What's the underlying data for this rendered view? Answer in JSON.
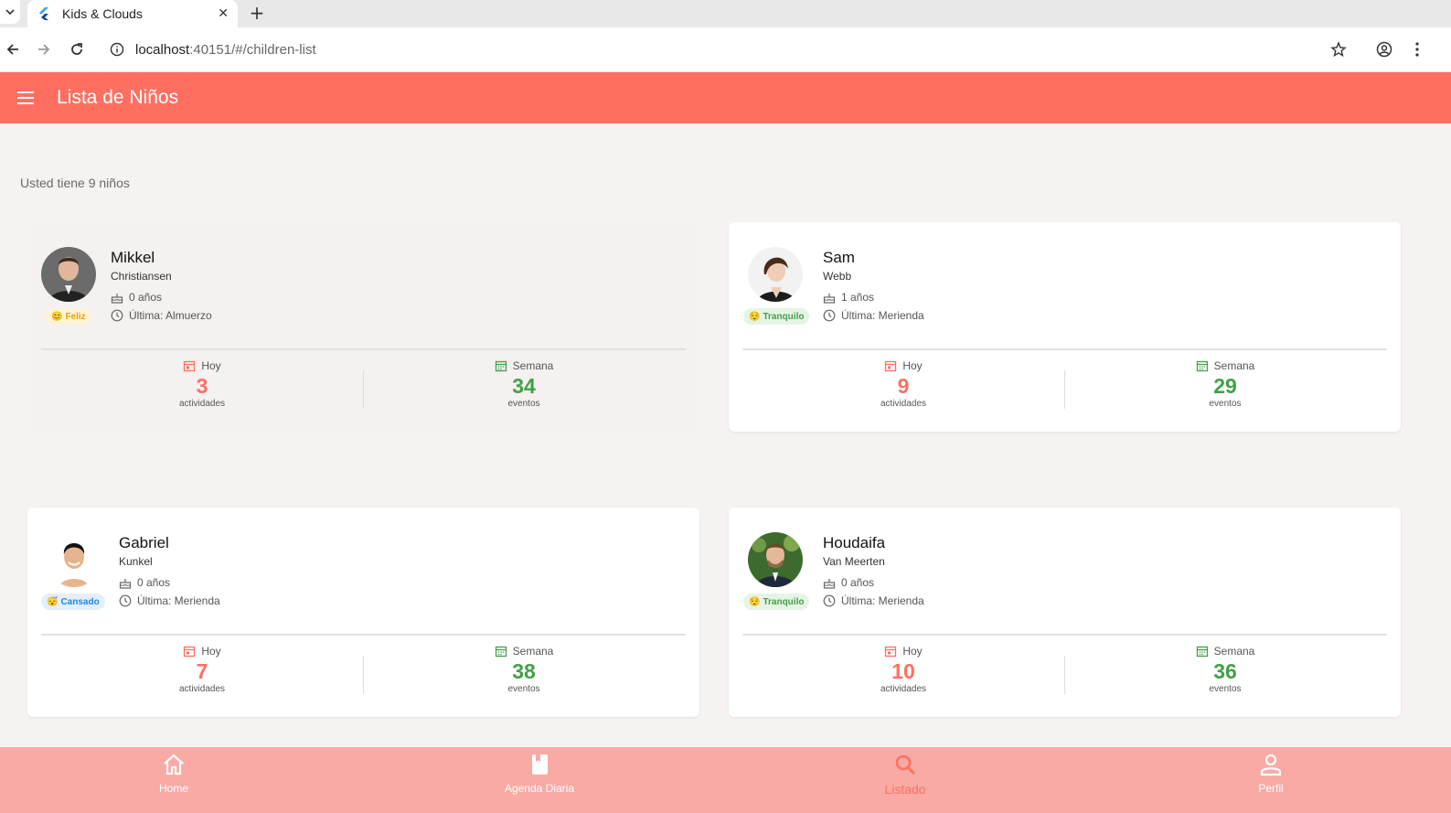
{
  "browser": {
    "tab_title": "Kids & Clouds",
    "url_host": "localhost",
    "url_rest": ":40151/#/children-list"
  },
  "appbar": {
    "title": "Lista de Niños"
  },
  "summary": "Usted tiene 9 niños",
  "colors": {
    "primary": "#ff6f61",
    "green": "#43a047",
    "nav_bg": "#f9aaa5"
  },
  "children": [
    {
      "first_name": "Mikkel",
      "last_name": "Christiansen",
      "age": "0 años",
      "last": "Última: Almuerzo",
      "mood": "Feliz",
      "mood_face": "😊",
      "today_label": "Hoy",
      "today_value": "3",
      "today_unit": "actividades",
      "week_label": "Semana",
      "week_value": "34",
      "week_unit": "eventos"
    },
    {
      "first_name": "Sam",
      "last_name": "Webb",
      "age": "1 años",
      "last": "Última: Merienda",
      "mood": "Tranquilo",
      "mood_face": "😌",
      "today_label": "Hoy",
      "today_value": "9",
      "today_unit": "actividades",
      "week_label": "Semana",
      "week_value": "29",
      "week_unit": "eventos"
    },
    {
      "first_name": "Gabriel",
      "last_name": "Kunkel",
      "age": "0 años",
      "last": "Última: Merienda",
      "mood": "Cansado",
      "mood_face": "😴",
      "today_label": "Hoy",
      "today_value": "7",
      "today_unit": "actividades",
      "week_label": "Semana",
      "week_value": "38",
      "week_unit": "eventos"
    },
    {
      "first_name": "Houdaifa",
      "last_name": "Van Meerten",
      "age": "0 años",
      "last": "Última: Merienda",
      "mood": "Tranquilo",
      "mood_face": "😌",
      "today_label": "Hoy",
      "today_value": "10",
      "today_unit": "actividades",
      "week_label": "Semana",
      "week_value": "36",
      "week_unit": "eventos"
    }
  ],
  "bottom_nav": [
    {
      "label": "Home",
      "icon": "home-icon"
    },
    {
      "label": "Agenda Diaria",
      "icon": "book-icon"
    },
    {
      "label": "Listado",
      "icon": "search-icon"
    },
    {
      "label": "Perfil",
      "icon": "person-icon"
    }
  ]
}
